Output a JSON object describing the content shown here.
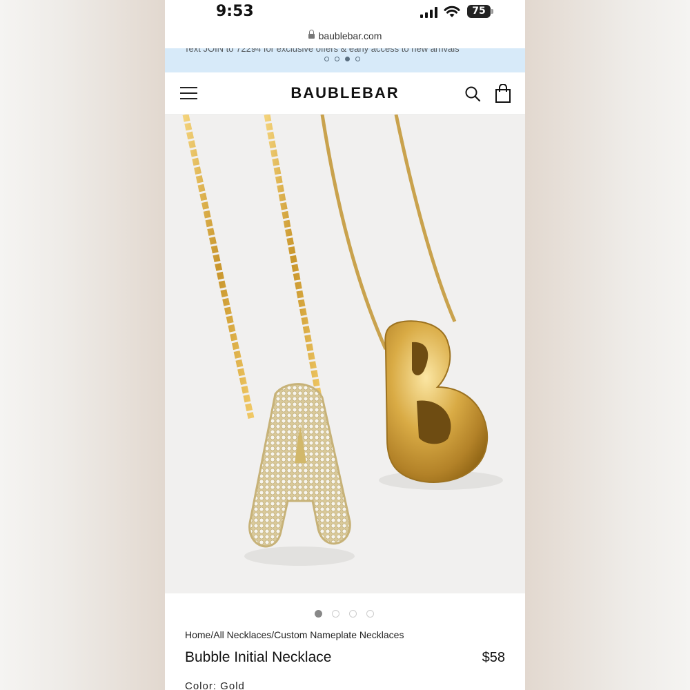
{
  "status_bar": {
    "time": "9:53",
    "battery": "75"
  },
  "browser": {
    "url": "baublebar.com"
  },
  "promo": {
    "text": "Text JOIN to 72294 for exclusive offers & early access to new arrivals",
    "dots": 4,
    "active_dot": 2
  },
  "nav": {
    "brand": "BAUBLEBAR",
    "icons": [
      "menu-icon",
      "search-icon",
      "bag-icon"
    ]
  },
  "product": {
    "image_carousel": {
      "count": 4,
      "active": 0
    },
    "breadcrumb": "Home/All Necklaces/Custom Nameplate Necklaces",
    "title": "Bubble Initial Necklace",
    "price": "$58",
    "color_label": "Color: Gold"
  },
  "colors": {
    "promo_bg": "#d7eaf9",
    "gold": "#d4a93a",
    "image_bg": "#f1f0ef"
  }
}
